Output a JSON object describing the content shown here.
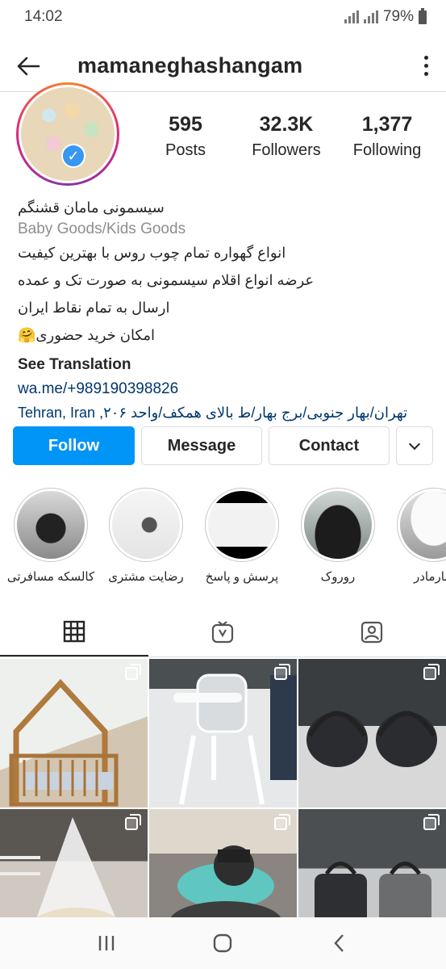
{
  "status": {
    "time": "14:02",
    "battery": "79%"
  },
  "header": {
    "username": "mamaneghashangam"
  },
  "stats": [
    {
      "value": "595",
      "label": "Posts"
    },
    {
      "value": "32.3K",
      "label": "Followers"
    },
    {
      "value": "1,377",
      "label": "Following"
    }
  ],
  "bio": {
    "name": "سیسمونی مامان قشنگم",
    "category": "Baby Goods/Kids Goods",
    "lines": [
      "انواع گهواره تمام چوب روس با بهترین کیفیت",
      "عرضه انواع اقلام سیسمونی به صورت تک و عمده",
      "ارسال به تمام نقاط ایران",
      "امکان خرید حضوری🤗"
    ],
    "see_translation": "See Translation",
    "link": "wa.me/+989190398826",
    "address": "تهران/بهار جنوبی/برج بهار/ط بالای همکف/واحد ۲۰۶, Tehran, Iran"
  },
  "buttons": {
    "follow": "Follow",
    "message": "Message",
    "contact": "Contact"
  },
  "highlights": [
    {
      "label": "کالسکه مسافرتی"
    },
    {
      "label": "رضایت مشتری"
    },
    {
      "label": "پرسش و پاسخ"
    },
    {
      "label": "روروک"
    },
    {
      "label": "کنارمادر"
    }
  ],
  "tabs": [
    "grid",
    "igtv",
    "tagged"
  ],
  "posts": [
    {
      "desc": "wooden house bed"
    },
    {
      "desc": "high chair"
    },
    {
      "desc": "car seats"
    },
    {
      "desc": "bassinet with net"
    },
    {
      "desc": "baby walker"
    },
    {
      "desc": "diaper bags"
    }
  ],
  "colors": {
    "accent": "#0095f6",
    "link": "#00376b"
  }
}
